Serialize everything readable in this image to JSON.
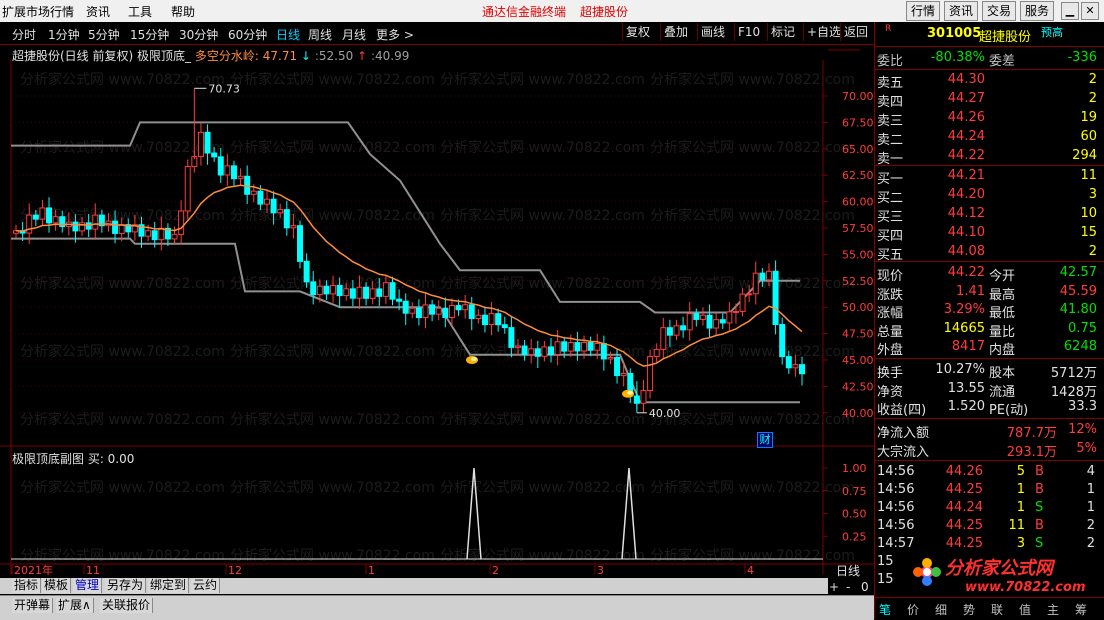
{
  "menu": {
    "items": [
      "扩展市场行情",
      "资讯",
      "工具",
      "帮助"
    ],
    "center": [
      "通达信金融终端",
      "超捷股份"
    ],
    "right_buttons": [
      "行情",
      "资讯",
      "交易",
      "服务"
    ]
  },
  "toolbar": {
    "periods": [
      "分时",
      "1分钟",
      "5分钟",
      "15分钟",
      "30分钟",
      "60分钟",
      "日线",
      "周线",
      "月线",
      "更多 >"
    ],
    "active": "日线",
    "tools": [
      "复权",
      "叠加",
      "画线",
      "F10",
      "标记",
      "+自选",
      "返回"
    ]
  },
  "info": {
    "stock": "超捷股份(日线 前复权)",
    "indicator": "极限顶底_",
    "label": "多空分水岭:",
    "val1": "47.71",
    "arrow1": "↓",
    "val2": "52.50",
    "arrow2": "↑",
    "val3": "40.99"
  },
  "chart": {
    "yticks": [
      "70.00",
      "67.50",
      "65.00",
      "62.50",
      "60.00",
      "57.50",
      "55.00",
      "52.50",
      "50.00",
      "47.50",
      "45.00",
      "42.50",
      "40.00"
    ],
    "high_label": "70.73",
    "low_label": "40.00",
    "badge": "财",
    "sub_title": "极限顶底副图 买: 0.00",
    "sub_yticks": [
      "1.00",
      "0.75",
      "0.50",
      "0.25"
    ],
    "xlabels": [
      "2021年",
      "11",
      "12",
      "1",
      "2",
      "3",
      "4"
    ],
    "period_label": "日线",
    "nav": [
      "+",
      "-",
      "0"
    ],
    "watermark": "分析家公式网 www.70822.com"
  },
  "tabs": [
    "指标",
    "模板",
    "管理",
    "另存为",
    "绑定到",
    "云约"
  ],
  "tabs2": [
    "开弹幕",
    "扩展∧",
    "关联报价"
  ],
  "quote": {
    "code": "301005",
    "name": "超捷股份",
    "badge": "R",
    "tag": "预高",
    "weibi_label": "委比",
    "weibi": "-80.38%",
    "weicha_label": "委差",
    "weicha": "-336",
    "asks": [
      {
        "label": "卖五",
        "price": "44.30",
        "vol": "2"
      },
      {
        "label": "卖四",
        "price": "44.27",
        "vol": "2"
      },
      {
        "label": "卖三",
        "price": "44.26",
        "vol": "19"
      },
      {
        "label": "卖二",
        "price": "44.24",
        "vol": "60"
      },
      {
        "label": "卖一",
        "price": "44.22",
        "vol": "294"
      }
    ],
    "bids": [
      {
        "label": "买一",
        "price": "44.21",
        "vol": "11"
      },
      {
        "label": "买二",
        "price": "44.20",
        "vol": "3"
      },
      {
        "label": "买三",
        "price": "44.12",
        "vol": "10"
      },
      {
        "label": "买四",
        "price": "44.10",
        "vol": "15"
      },
      {
        "label": "买五",
        "price": "44.08",
        "vol": "2"
      }
    ],
    "stats": [
      {
        "l1": "现价",
        "v1": "44.22",
        "c1": "red",
        "l2": "今开",
        "v2": "42.57",
        "c2": "grn"
      },
      {
        "l1": "涨跌",
        "v1": "1.41",
        "c1": "red",
        "l2": "最高",
        "v2": "45.59",
        "c2": "red"
      },
      {
        "l1": "涨幅",
        "v1": "3.29%",
        "c1": "red",
        "l2": "最低",
        "v2": "41.80",
        "c2": "grn"
      },
      {
        "l1": "总量",
        "v1": "14665",
        "c1": "yel",
        "l2": "量比",
        "v2": "0.75",
        "c2": "grn"
      },
      {
        "l1": "外盘",
        "v1": "8417",
        "c1": "red",
        "l2": "内盘",
        "v2": "6248",
        "c2": "grn"
      }
    ],
    "stats2": [
      {
        "l1": "换手",
        "v1": "10.27%",
        "c1": "wht",
        "l2": "股本",
        "v2": "5712万",
        "c2": "wht"
      },
      {
        "l1": "净资",
        "v1": "13.55",
        "c1": "wht",
        "l2": "流通",
        "v2": "1428万",
        "c2": "wht"
      },
      {
        "l1": "收益(四)",
        "v1": "1.520",
        "c1": "wht",
        "l2": "PE(动)",
        "v2": "33.3",
        "c2": "wht"
      }
    ],
    "flows": [
      {
        "label": "净流入额",
        "val": "787.7万",
        "pct": "12%"
      },
      {
        "label": "大宗流入",
        "val": "293.1万",
        "pct": "5%"
      }
    ],
    "ticks": [
      {
        "time": "14:56",
        "price": "44.26",
        "vol": "5",
        "side": "B",
        "n": "4"
      },
      {
        "time": "14:56",
        "price": "44.25",
        "vol": "1",
        "side": "B",
        "n": "1"
      },
      {
        "time": "14:56",
        "price": "44.24",
        "vol": "1",
        "side": "S",
        "n": "1"
      },
      {
        "time": "14:56",
        "price": "44.25",
        "vol": "11",
        "side": "B",
        "n": "2"
      },
      {
        "time": "14:57",
        "price": "44.25",
        "vol": "3",
        "side": "S",
        "n": "2"
      },
      {
        "time": "15",
        "price": "",
        "vol": "",
        "side": "",
        "n": ""
      },
      {
        "time": "15",
        "price": "",
        "vol": "",
        "side": "",
        "n": ""
      }
    ],
    "logo_text": "分析家公式网",
    "logo_url": "www.70822.com",
    "bottom_tabs": [
      "笔",
      "价",
      "细",
      "势",
      "联",
      "值",
      "主",
      "筹"
    ]
  },
  "colors": {
    "bg": "#000000",
    "up": "#ff3c3c",
    "down": "#00ffff",
    "frame": "#800000",
    "ma": "#ff8c3c",
    "band": "#909090"
  }
}
